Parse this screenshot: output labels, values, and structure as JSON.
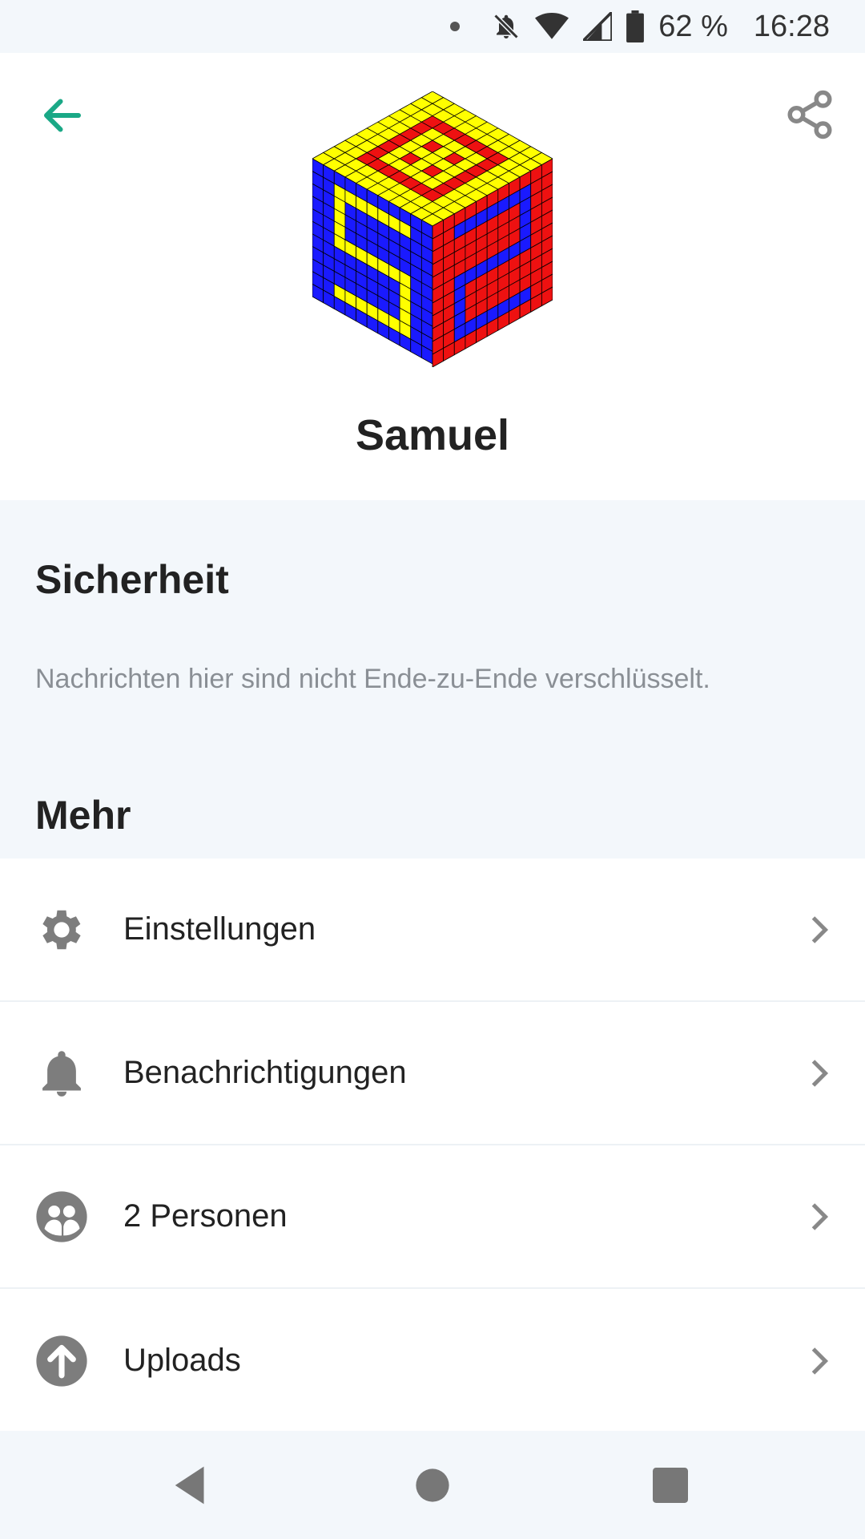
{
  "status_bar": {
    "battery": "62 %",
    "time": "16:28"
  },
  "header": {
    "name": "Samuel",
    "icons": {
      "back": "arrow-left-icon",
      "share": "share-icon"
    },
    "accent_color": "#1aa886"
  },
  "security": {
    "title": "Sicherheit",
    "text": "Nachrichten hier sind nicht Ende-zu-Ende verschlüsselt."
  },
  "more": {
    "title": "Mehr",
    "items": [
      {
        "label": "Einstellungen",
        "icon": "gear-icon"
      },
      {
        "label": "Benachrichtigungen",
        "icon": "bell-icon"
      },
      {
        "label": "2 Personen",
        "icon": "people-icon"
      },
      {
        "label": "Uploads",
        "icon": "upload-icon"
      }
    ]
  },
  "nav": {
    "icons": [
      "back-triangle-icon",
      "home-circle-icon",
      "recents-square-icon"
    ]
  }
}
